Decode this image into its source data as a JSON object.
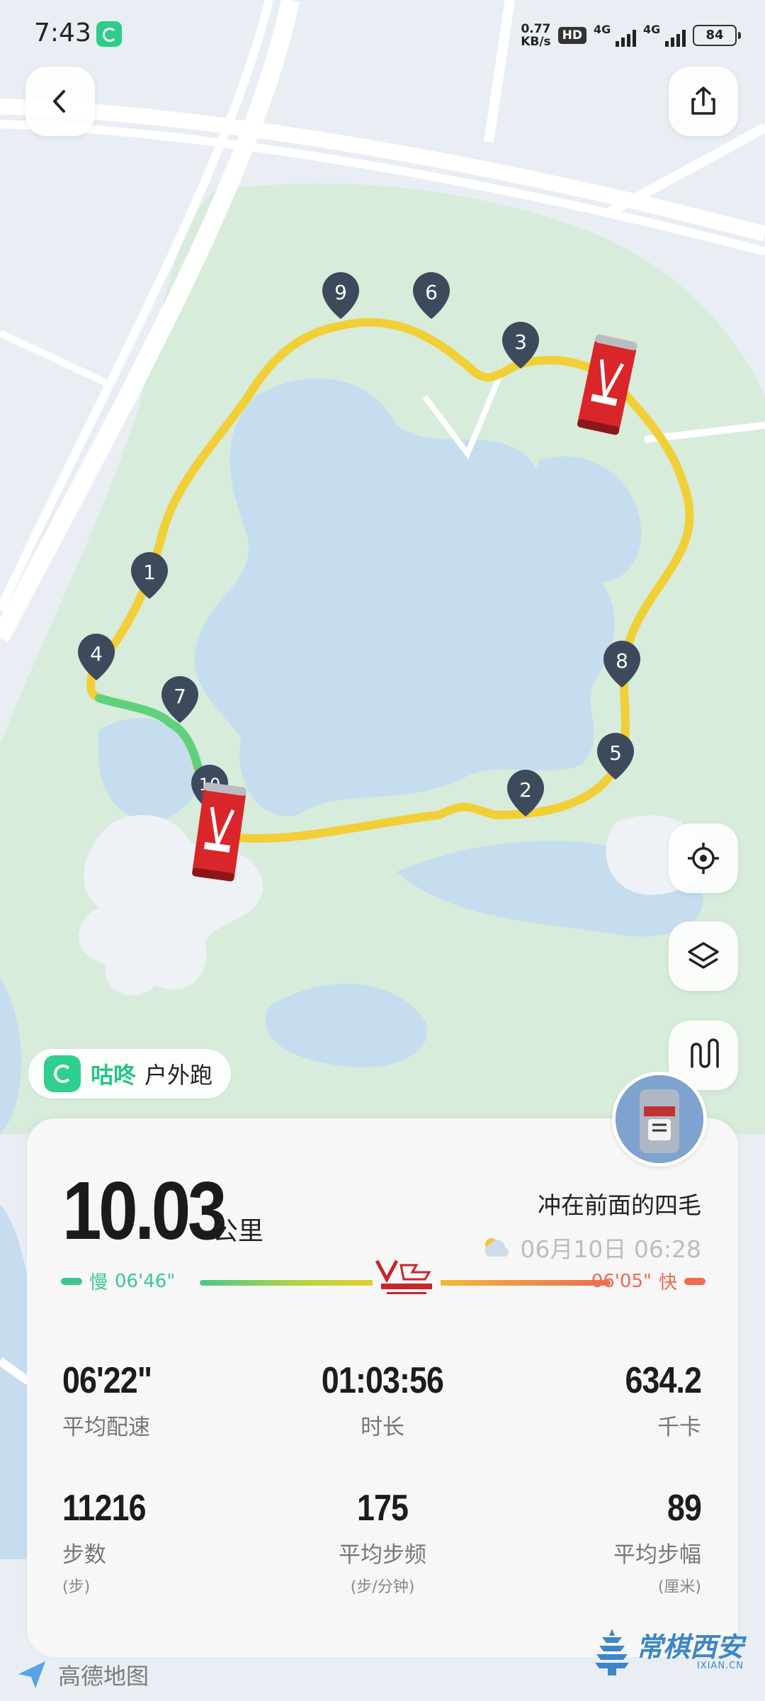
{
  "status_bar": {
    "time": "7:43",
    "net_speed_value": "0.77",
    "net_speed_unit": "KB/s",
    "hd_badge": "HD",
    "net1": "4G",
    "net2": "4G",
    "battery": "84"
  },
  "map": {
    "route_markers": [
      "1",
      "2",
      "3",
      "4",
      "5",
      "6",
      "7",
      "8",
      "9",
      "10"
    ],
    "route_color": "#f1cf37",
    "fast_segment_color": "#5fd17d",
    "water_color": "#c5dcf0",
    "park_color": "#d7ebdc",
    "road_color": "#ffffff"
  },
  "brand": {
    "name": "咕咚",
    "activity_type": "户外跑"
  },
  "summary": {
    "distance": "10.03",
    "distance_unit": "公里",
    "user_name": "冲在前面的四毛",
    "datetime": "06月10日 06:28",
    "pace_slow_label": "慢",
    "pace_slow_value": "06'46\"",
    "pace_fast_value": "06'05\"",
    "pace_fast_label": "快"
  },
  "stats": [
    {
      "value": "06'22\"",
      "label": "平均配速",
      "sub": ""
    },
    {
      "value": "01:03:56",
      "label": "时长",
      "sub": ""
    },
    {
      "value": "634.2",
      "label": "千卡",
      "sub": ""
    },
    {
      "value": "11216",
      "label": "步数",
      "sub": "(步)"
    },
    {
      "value": "175",
      "label": "平均步频",
      "sub": "(步/分钟)"
    },
    {
      "value": "89",
      "label": "平均步幅",
      "sub": "(厘米)"
    }
  ],
  "footer": {
    "map_provider": "高德地图",
    "watermark": "常棋西安",
    "watermark_url": "IXIAN.CN"
  },
  "colors": {
    "accent_green": "#24c584",
    "slow_green": "#3dc78c",
    "fast_red": "#ee6a4f"
  }
}
